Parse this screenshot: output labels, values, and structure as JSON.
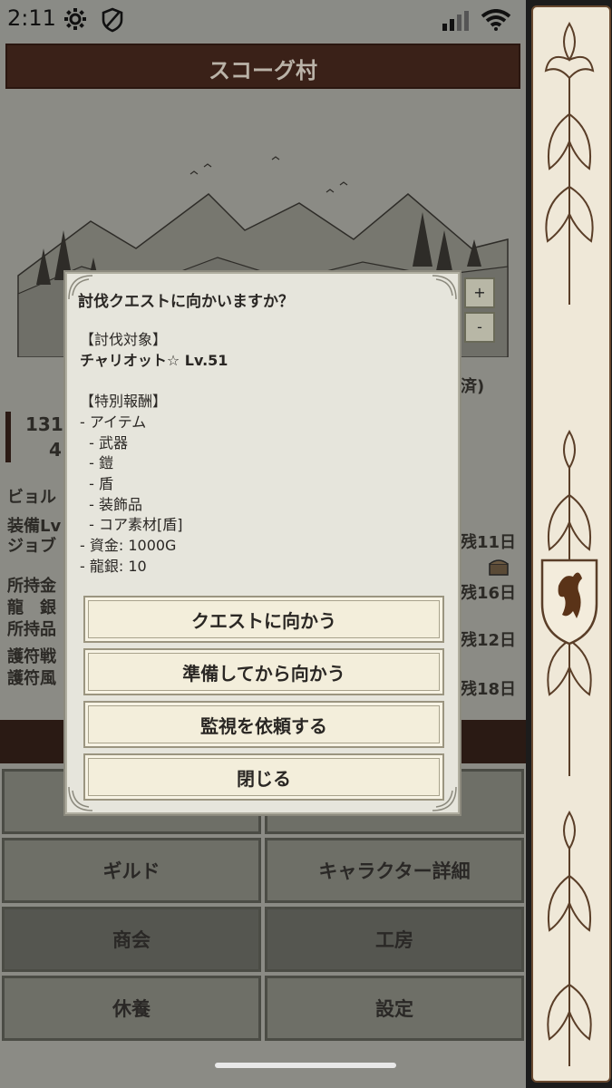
{
  "status_bar": {
    "time": "2:11"
  },
  "game": {
    "village_title": "スコーグ村",
    "side_labels": [
      "ビョル",
      "装備Lv",
      "ジョブ",
      "所持金",
      "龍　銀",
      "所持品",
      "護符戦",
      "護符風"
    ],
    "stat_values": [
      "131",
      "4"
    ],
    "right_fragments": [
      "済)",
      "残11日",
      "残16日",
      "残12日",
      "残18日"
    ],
    "zoom_in": "+",
    "zoom_out": "-",
    "menu": [
      {
        "label": "ギルド"
      },
      {
        "label": "キャラクター詳細"
      },
      {
        "label": "商会"
      },
      {
        "label": "工房"
      },
      {
        "label": "休養"
      },
      {
        "label": "設定"
      }
    ]
  },
  "dialog": {
    "question": "討伐クエストに向かいますか？",
    "target_header": "【討伐対象】",
    "target_name": "チャリオット☆ Lv.51",
    "reward_header": "【特別報酬】",
    "reward_lines": [
      "- アイテム",
      "  - 武器",
      "  - 鎧",
      "  - 盾",
      "  - 装飾品",
      "  - コア素材[盾]",
      "- 資金: 1000G",
      "- 龍銀: 10"
    ],
    "buttons": {
      "go_quest": "クエストに向かう",
      "prepare": "準備してから向かう",
      "request_watch": "監視を依頼する",
      "close": "閉じる"
    }
  }
}
